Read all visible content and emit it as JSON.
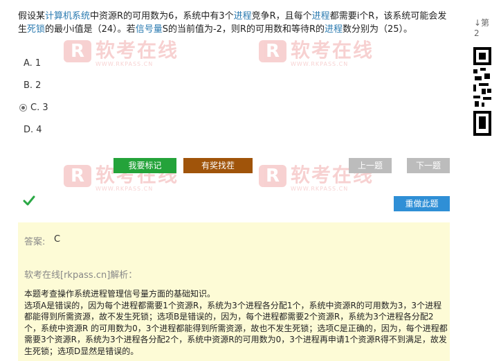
{
  "question": {
    "parts": [
      {
        "t": "假设某",
        "kw": false
      },
      {
        "t": "计算机系统",
        "kw": true
      },
      {
        "t": "中资源R的可用数为6，系统中有3个",
        "kw": false
      },
      {
        "t": "进程",
        "kw": true
      },
      {
        "t": "竞争R，且每个",
        "kw": false
      },
      {
        "t": "进程",
        "kw": true
      },
      {
        "t": "都需要i个R，该系统可能会发生",
        "kw": false
      },
      {
        "t": "死锁",
        "kw": true
      },
      {
        "t": "的最小i值是（24）。若",
        "kw": false
      },
      {
        "t": "信号量",
        "kw": true
      },
      {
        "t": "S的当前值为-2，则R的可用数和等待R的",
        "kw": false
      },
      {
        "t": "进程",
        "kw": true
      },
      {
        "t": "数分别为（25）。",
        "kw": false
      }
    ]
  },
  "options": [
    {
      "label": "A.  1",
      "selected": false
    },
    {
      "label": "B.  2",
      "selected": false
    },
    {
      "label": "C.  3",
      "selected": true
    },
    {
      "label": "D.  4",
      "selected": false
    }
  ],
  "buttons": {
    "mark": "我要标记",
    "report": "有奖找茬",
    "prev": "上一题",
    "next": "下一题",
    "redo": "重做此题"
  },
  "answer": {
    "label": "答案:",
    "value": "C",
    "explanation_title": "软考在线[rkpass.cn]解析：",
    "explanation": [
      "本题考查操作系统进程管理信号量方面的基础知识。",
      "选项A是错误的，因为每个进程都需要1个资源R，系统为3个进程各分配1个，系统中资源R的可用数为3，3个进程都能得到所需资源，故不发生死锁；选项B是错误的，因为，每个进程都需要2个资源R，系统为3个进程各分配2个，系统中资源R 的可用数为0，3个进程都能得到所需资源，故也不发生死锁；选项C是正确的，因为，每个进程都需要3个资源R，系统为3个进程各分配2个，系统中资源R的可用数为0，3个进程再申请1个资源R得不到满足，故发生死锁；选项D显然是错误的。"
    ]
  },
  "watermark": {
    "logo": "R",
    "name": "软考在线",
    "url": "WWW.RKPASS.CN"
  },
  "side": {
    "label": "↓第2"
  },
  "colors": {
    "keyword": "#2a7ab0",
    "mark_btn": "#24a33a",
    "report_btn": "#a0540a",
    "nav_btn": "#bcbcbc",
    "redo_btn": "#2f8fd6",
    "answer_bg": "#fdfbd6"
  }
}
